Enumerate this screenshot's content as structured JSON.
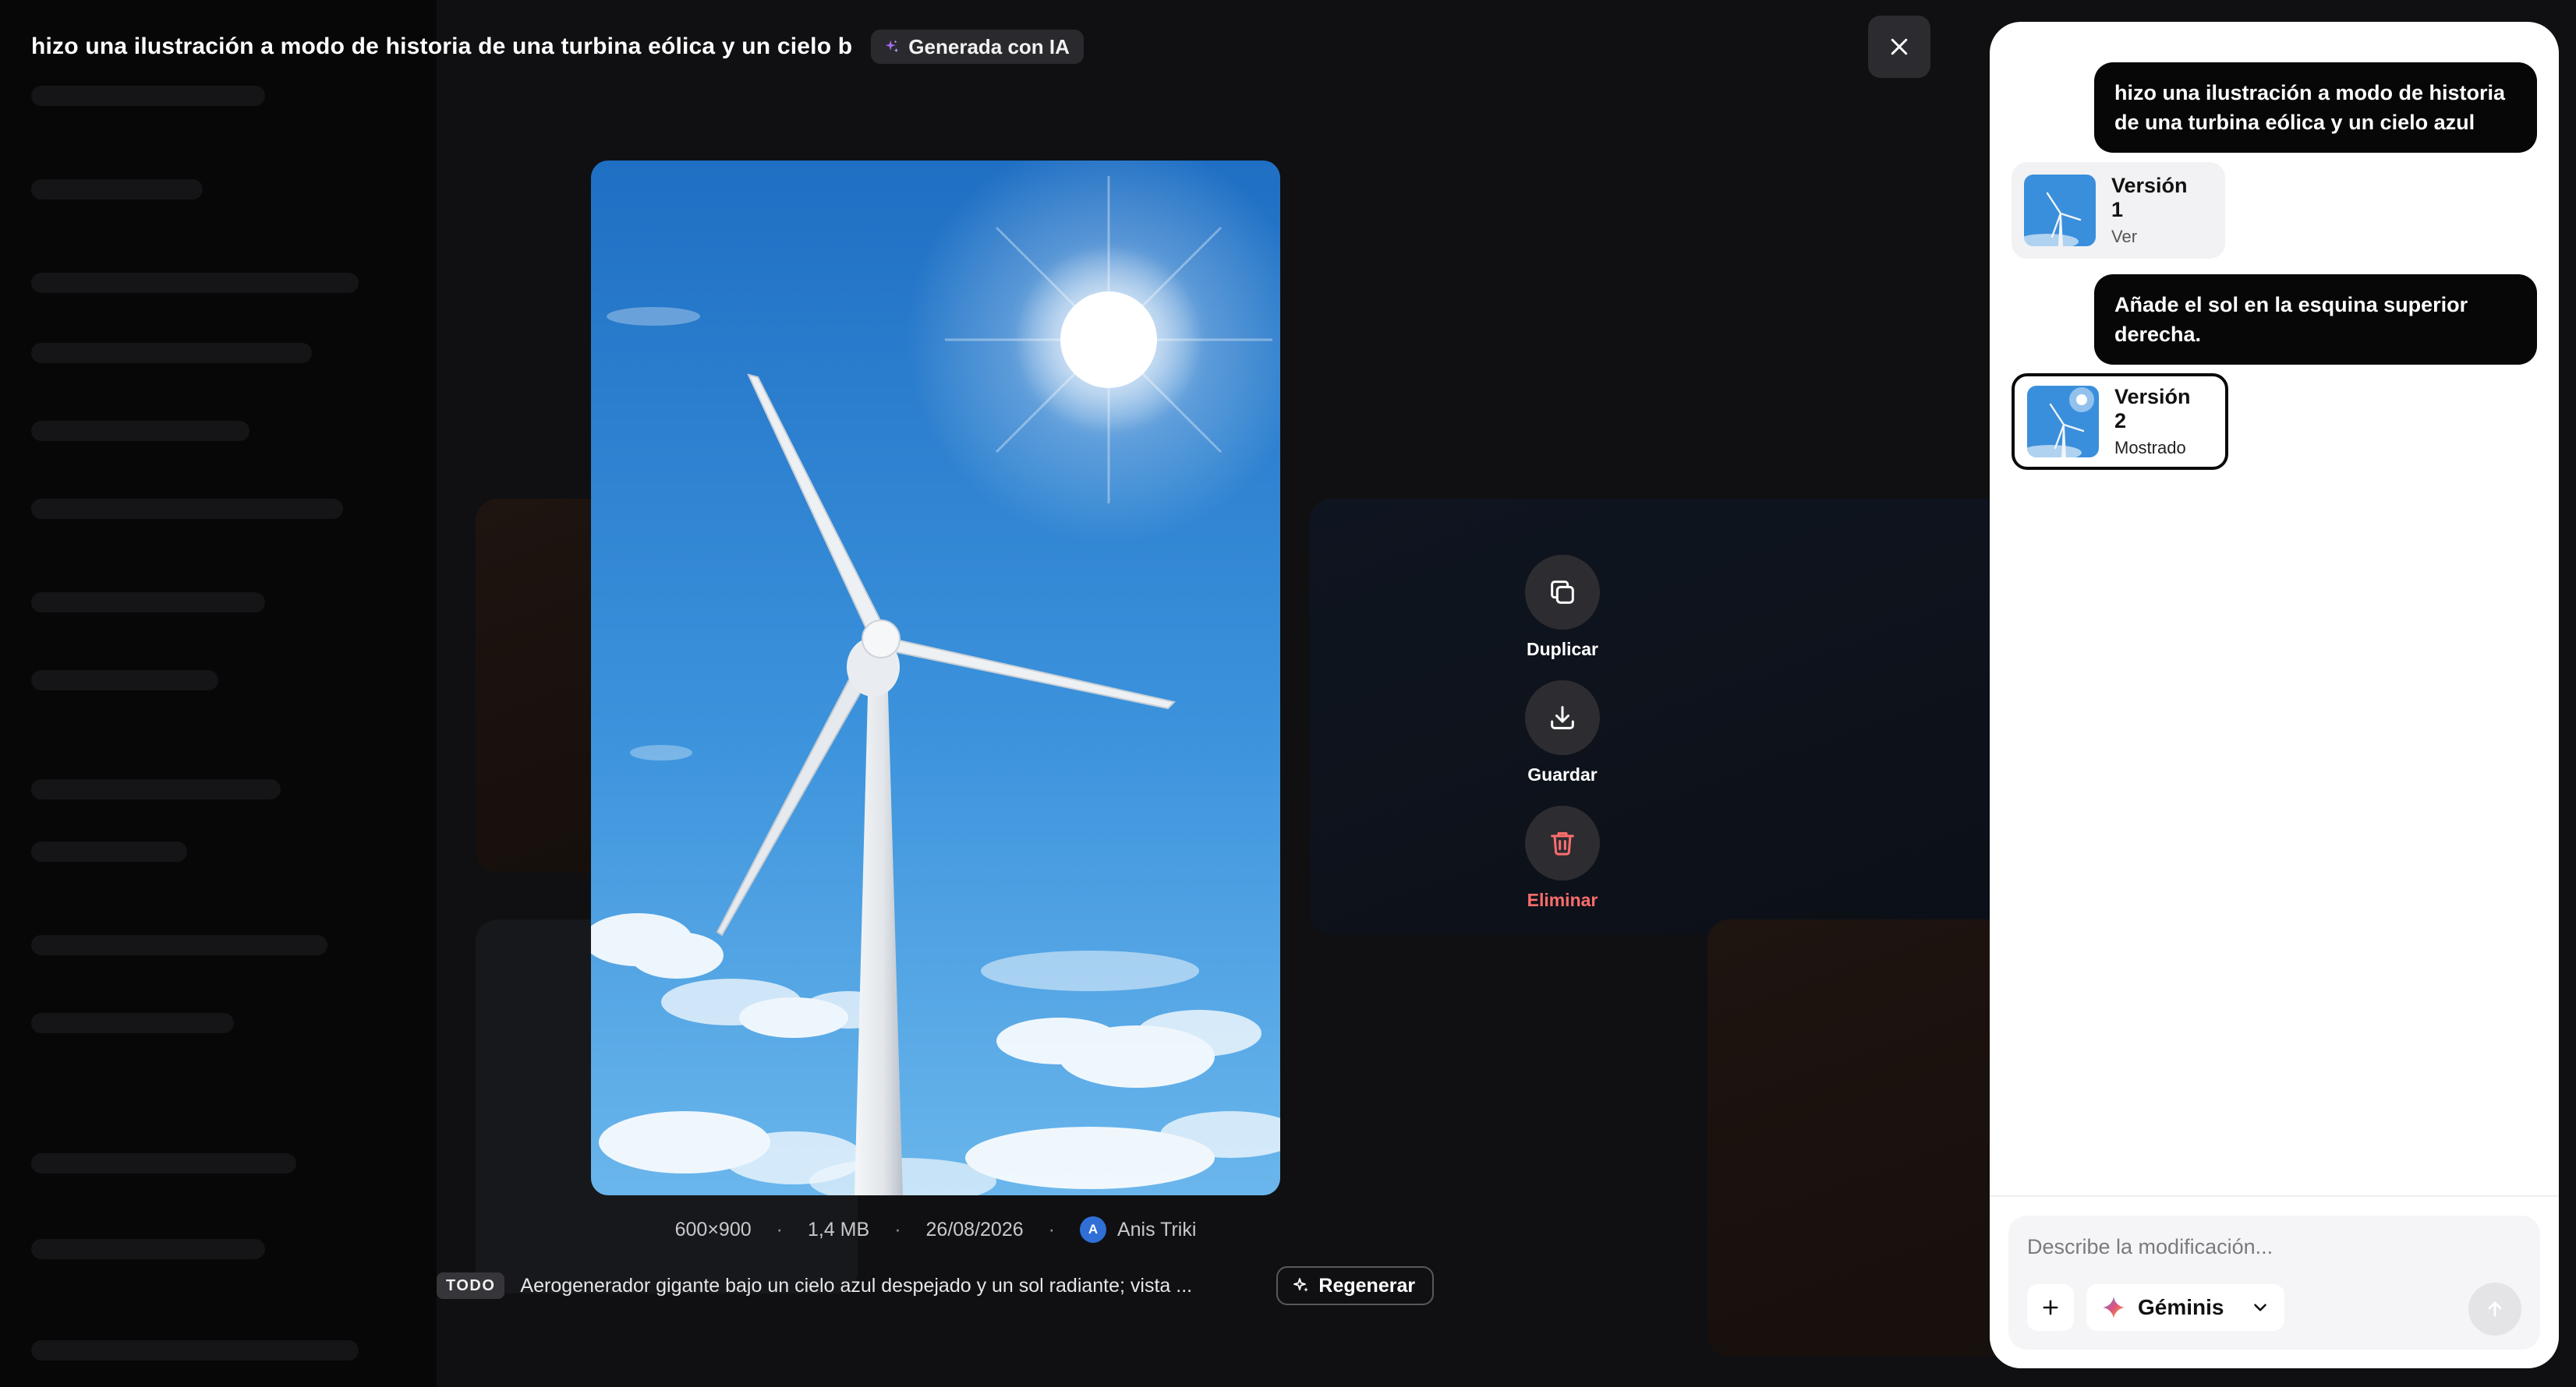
{
  "header": {
    "title": "hizo una ilustración a modo de historia de una turbina eólica y un cielo b",
    "ai_badge_label": "Generada con IA",
    "close_icon": "close-icon"
  },
  "actions": [
    {
      "label": "Duplicar",
      "icon": "duplicate-icon"
    },
    {
      "label": "Guardar",
      "icon": "download-icon"
    },
    {
      "label": "Eliminar",
      "icon": "trash-icon",
      "color": "#ff6d6d"
    }
  ],
  "meta": {
    "dimensions": "600×900",
    "size": "1,4 MB",
    "date": "26/08/2026",
    "separator": "·",
    "author_initial": "A",
    "author_name": "Anis Triki"
  },
  "prompt": {
    "badge": "TODO",
    "text": "Aerogenerador gigante bajo un cielo azul despejado y un sol radiante; vista ...",
    "regenerate_label": "Regenerar"
  },
  "chat": {
    "messages": [
      {
        "role": "user",
        "text": "hizo una ilustración a modo de historia de una turbina eólica y un cielo azul"
      },
      {
        "role": "version",
        "title": "Versión 1",
        "subtitle": "Ver"
      },
      {
        "role": "user",
        "text": "Añade el sol en la esquina superior derecha."
      },
      {
        "role": "version",
        "title": "Versión 2",
        "subtitle": "Mostrado",
        "selected": true
      }
    ],
    "composer": {
      "placeholder": "Describe la modificación...",
      "model": "Géminis"
    }
  },
  "colors": {
    "accent_ai": "#a86bff",
    "danger": "#ff6d6d",
    "avatar": "#2f6fd6",
    "sky_top": "#1f74c9",
    "sky_bottom": "#5aaee8"
  }
}
